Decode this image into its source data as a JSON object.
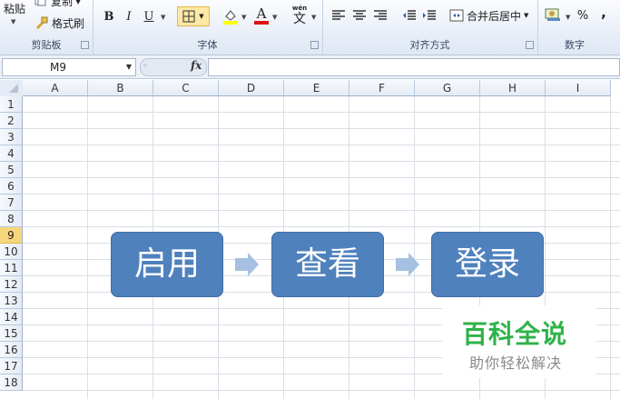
{
  "ribbon": {
    "clipboard": {
      "paste_label": "粘贴",
      "copy_label": "复制",
      "format_painter_label": "格式刷",
      "group_label": "剪贴板"
    },
    "font": {
      "bold": "B",
      "italic": "I",
      "underline": "U",
      "font_color": "A",
      "group_label": "字体"
    },
    "alignment": {
      "merge_center_label": "合并后居中",
      "wen_label": "wén",
      "wen_char": "文",
      "group_label": "对齐方式"
    },
    "number": {
      "percent": "%",
      "comma": ",",
      "group_label": "数字"
    }
  },
  "formula_bar": {
    "name_box": "M9",
    "fx_label": "fx",
    "content": ""
  },
  "columns": [
    "A",
    "B",
    "C",
    "D",
    "E",
    "F",
    "G",
    "H",
    "I"
  ],
  "rows": [
    "1",
    "2",
    "3",
    "4",
    "5",
    "6",
    "7",
    "8",
    "9",
    "10",
    "11",
    "12",
    "13",
    "14",
    "15",
    "16",
    "17",
    "18"
  ],
  "selected_row": "9",
  "smartart": {
    "steps": [
      "启用",
      "查看",
      "登录"
    ],
    "box_color": "#4f81bd",
    "arrow_color": "#a5c0e0"
  },
  "watermark": {
    "title": "百科全说",
    "subtitle": "助你轻松解决",
    "color": "#2fb24a"
  }
}
